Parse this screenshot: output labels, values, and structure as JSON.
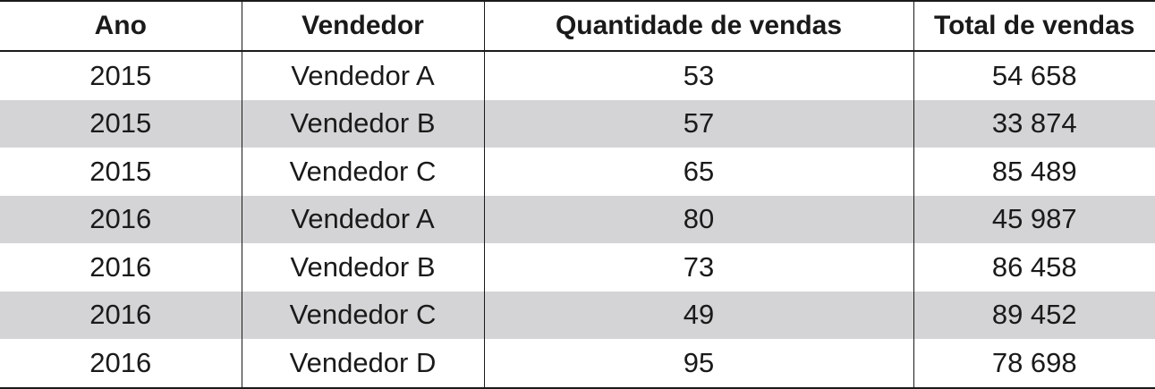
{
  "table": {
    "headers": [
      "Ano",
      "Vendedor",
      "Quantidade de vendas",
      "Total de vendas"
    ],
    "rows": [
      [
        "2015",
        "Vendedor A",
        "53",
        "54 658"
      ],
      [
        "2015",
        "Vendedor B",
        "57",
        "33 874"
      ],
      [
        "2015",
        "Vendedor C",
        "65",
        "85 489"
      ],
      [
        "2016",
        "Vendedor A",
        "80",
        "45 987"
      ],
      [
        "2016",
        "Vendedor B",
        "73",
        "86 458"
      ],
      [
        "2016",
        "Vendedor C",
        "49",
        "89 452"
      ],
      [
        "2016",
        "Vendedor D",
        "95",
        "78 698"
      ]
    ],
    "colors": {
      "stripe": "#d4d4d6",
      "text": "#1a1a1a",
      "rule": "#1a1a1a"
    }
  }
}
